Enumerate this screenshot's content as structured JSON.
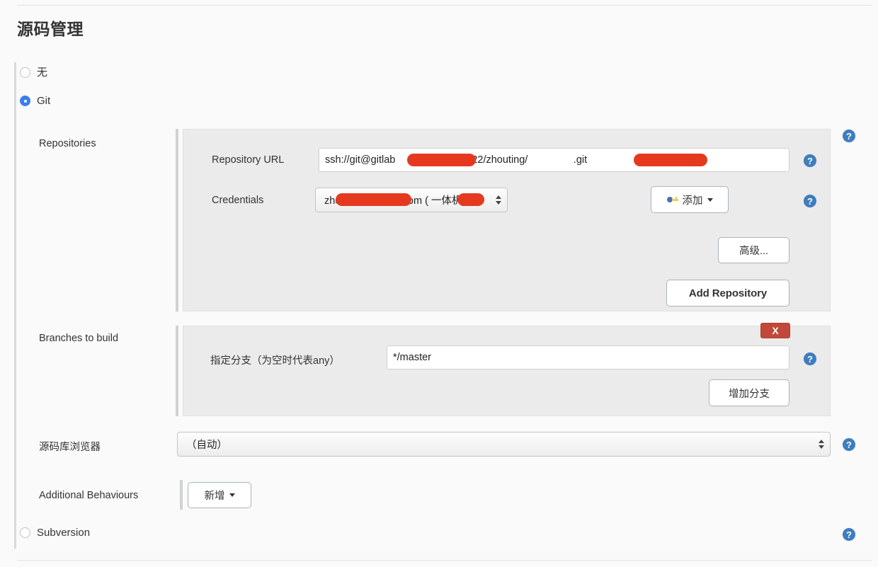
{
  "page": {
    "title": "源码管理"
  },
  "scm_options": [
    {
      "label": "无",
      "checked": false,
      "name": "none"
    },
    {
      "label": "Git",
      "checked": true,
      "name": "git"
    },
    {
      "label": "Subversion",
      "checked": false,
      "name": "subversion"
    }
  ],
  "git": {
    "repositories": {
      "label": "Repositories",
      "repository_url": {
        "label": "Repository URL",
        "value": "ssh://git@gitlab              .com:2222/zhouting/                .git",
        "value_visible_prefix": "ssh://git@gitlab",
        "value_visible_middle": ".com:2222/zhouting/",
        "value_visible_suffix": ".git",
        "placeholder": ""
      },
      "credentials": {
        "label": "Credentials",
        "selected": "zhouting (                @163.com (        一体机) )",
        "selected_prefix": "zhouting (",
        "selected_middle": "@163.com （",
        "selected_suffix": "一体机）)",
        "add_button": "添加"
      },
      "advanced_button": "高级...",
      "add_repository_button": "Add Repository"
    },
    "branches": {
      "label": "Branches to build",
      "branch_spec": {
        "label": "指定分支（为空时代表any）",
        "value": "*/master",
        "placeholder": ""
      },
      "delete_button": "X",
      "add_branch_button": "增加分支"
    },
    "browser": {
      "label": "源码库浏览器",
      "selected": "（自动）",
      "options": [
        "（自动）"
      ]
    },
    "additional_behaviours": {
      "label": "Additional Behaviours",
      "add_button": "新增"
    }
  },
  "help_icon_label": "?",
  "colors": {
    "accent_radio": "#3b7ded",
    "help_bubble": "#3e7dbf",
    "delete_button": "#c1483a",
    "redaction": "#e5391f",
    "panel_bg": "#ebebeb",
    "page_bg": "#fafafa"
  }
}
